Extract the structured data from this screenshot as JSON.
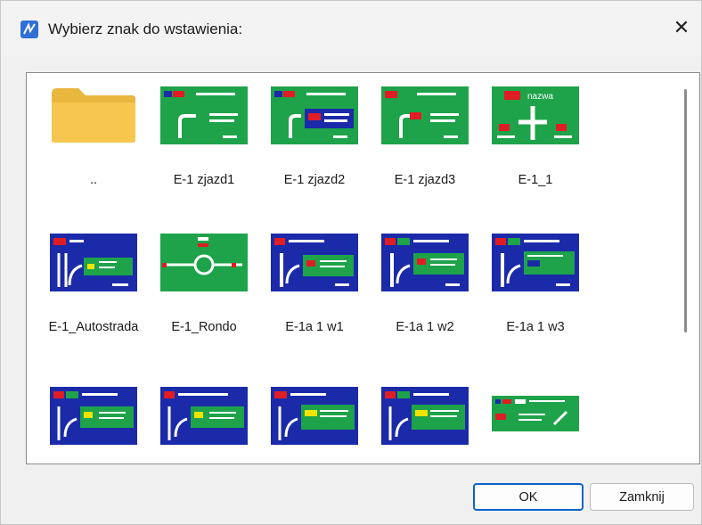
{
  "window": {
    "title": "Wybierz znak do wstawienia:",
    "close_glyph": "✕"
  },
  "items": [
    {
      "label": "..",
      "kind": "folder"
    },
    {
      "label": "E-1 zjazd1",
      "kind": "sign"
    },
    {
      "label": "E-1 zjazd2",
      "kind": "sign"
    },
    {
      "label": "E-1 zjazd3",
      "kind": "sign"
    },
    {
      "label": "E-1_1",
      "kind": "sign"
    },
    {
      "label": "E-1_Autostrada",
      "kind": "sign"
    },
    {
      "label": "E-1_Rondo",
      "kind": "sign"
    },
    {
      "label": "E-1a 1 w1",
      "kind": "sign"
    },
    {
      "label": "E-1a 1 w2",
      "kind": "sign"
    },
    {
      "label": "E-1a 1 w3",
      "kind": "sign"
    },
    {
      "label": "",
      "kind": "sign"
    },
    {
      "label": "",
      "kind": "sign"
    },
    {
      "label": "",
      "kind": "sign"
    },
    {
      "label": "",
      "kind": "sign"
    },
    {
      "label": "",
      "kind": "sign"
    }
  ],
  "sign_text": {
    "e1_1": "nazwa"
  },
  "buttons": {
    "ok": "OK",
    "close": "Zamknij"
  },
  "colors": {
    "green": "#1ea34a",
    "blue": "#1b2aa8",
    "red": "#e01d24",
    "folder": "#f6c64f",
    "accent": "#0a64c8"
  }
}
